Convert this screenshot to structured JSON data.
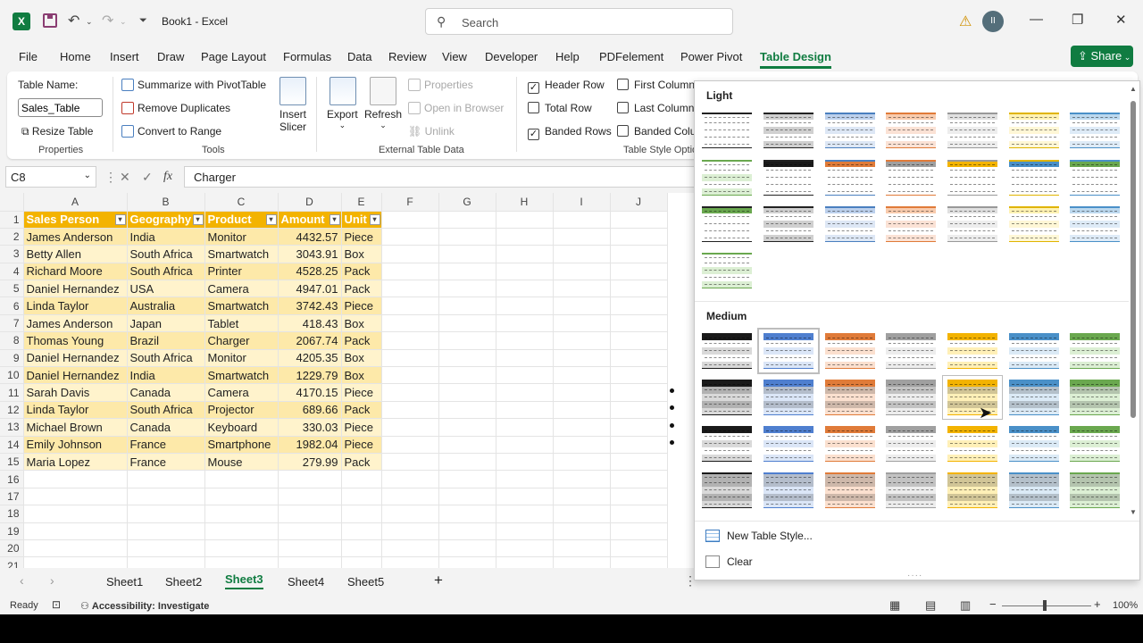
{
  "titlebar": {
    "title": "Book1  -  Excel",
    "search_placeholder": "Search",
    "avatar_initials": "II",
    "excel_letter": "X"
  },
  "menu": {
    "tabs": [
      "File",
      "Home",
      "Insert",
      "Draw",
      "Page Layout",
      "Formulas",
      "Data",
      "Review",
      "View",
      "Developer",
      "Help",
      "PDFelement",
      "Power Pivot",
      "Table Design"
    ],
    "active": "Table Design",
    "share": "Share"
  },
  "ribbon": {
    "properties": {
      "table_name_label": "Table Name:",
      "table_name_value": "Sales_Table",
      "resize": "Resize Table",
      "group": "Properties"
    },
    "tools": {
      "pivot": "Summarize with PivotTable",
      "dups": "Remove Duplicates",
      "range": "Convert to Range",
      "slicer_l1": "Insert",
      "slicer_l2": "Slicer",
      "group": "Tools"
    },
    "external": {
      "export": "Export",
      "refresh": "Refresh",
      "properties": "Properties",
      "open_browser": "Open in Browser",
      "unlink": "Unlink",
      "group": "External Table Data"
    },
    "style_options": {
      "header_row": "Header Row",
      "total_row": "Total Row",
      "banded_rows": "Banded Rows",
      "first_column": "First Column",
      "last_column": "Last Column",
      "banded_columns": "Banded Colu",
      "group": "Table Style Optio"
    }
  },
  "formula_bar": {
    "cell_ref": "C8",
    "fx": "fx",
    "value": "Charger"
  },
  "sheet": {
    "columns": [
      "A",
      "B",
      "C",
      "D",
      "E",
      "F",
      "G",
      "H",
      "I",
      "J"
    ],
    "headers": [
      "Sales Person",
      "Geography",
      "Product",
      "Amount",
      "Unit"
    ],
    "rows": [
      [
        "James Anderson",
        "India",
        "Monitor",
        "4432.57",
        "Piece"
      ],
      [
        "Betty Allen",
        "South Africa",
        "Smartwatch",
        "3043.91",
        "Box"
      ],
      [
        "Richard Moore",
        "South Africa",
        "Printer",
        "4528.25",
        "Pack"
      ],
      [
        "Daniel Hernandez",
        "USA",
        "Camera",
        "4947.01",
        "Pack"
      ],
      [
        "Linda Taylor",
        "Australia",
        "Smartwatch",
        "3742.43",
        "Piece"
      ],
      [
        "James Anderson",
        "Japan",
        "Tablet",
        "418.43",
        "Box"
      ],
      [
        "Thomas Young",
        "Brazil",
        "Charger",
        "2067.74",
        "Pack"
      ],
      [
        "Daniel Hernandez",
        "South Africa",
        "Monitor",
        "4205.35",
        "Box"
      ],
      [
        "Daniel Hernandez",
        "India",
        "Smartwatch",
        "1229.79",
        "Box"
      ],
      [
        "Sarah Davis",
        "Canada",
        "Camera",
        "4170.15",
        "Piece"
      ],
      [
        "Linda Taylor",
        "South Africa",
        "Projector",
        "689.66",
        "Pack"
      ],
      [
        "Michael Brown",
        "Canada",
        "Keyboard",
        "330.03",
        "Piece"
      ],
      [
        "Emily Johnson",
        "France",
        "Smartphone",
        "1982.04",
        "Piece"
      ],
      [
        "Maria Lopez",
        "France",
        "Mouse",
        "279.99",
        "Pack"
      ]
    ],
    "row_numbers": [
      "1",
      "2",
      "3",
      "4",
      "5",
      "6",
      "7",
      "8",
      "9",
      "10",
      "11",
      "12",
      "13",
      "14",
      "15",
      "16",
      "17",
      "18",
      "19",
      "20",
      "21"
    ]
  },
  "sheet_tabs": {
    "tabs": [
      "Sheet1",
      "Sheet2",
      "Sheet3",
      "Sheet4",
      "Sheet5"
    ],
    "active": "Sheet3",
    "add": "+"
  },
  "status": {
    "ready": "Ready",
    "accessibility": "Accessibility: Investigate",
    "zoom": "100%"
  },
  "gallery": {
    "light_label": "Light",
    "medium_label": "Medium",
    "new_style": "New Table Style...",
    "clear": "Clear"
  },
  "colors": {
    "excel_green": "#107c41",
    "table_header": "#f3b300",
    "band_a": "#fde9a9",
    "band_b": "#fff3cc"
  }
}
